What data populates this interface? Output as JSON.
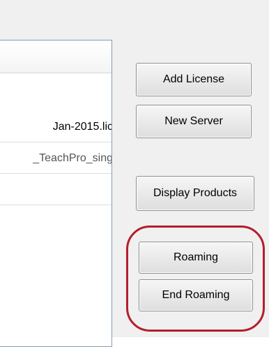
{
  "license_list": {
    "rows": [
      {
        "text": "Jan-2015.lic"
      },
      {
        "text": "_TeachPro_sing"
      },
      {
        "text": ""
      }
    ]
  },
  "buttons": {
    "add_license": "Add License",
    "new_server": "New Server",
    "display_products": "Display Products",
    "roaming": "Roaming",
    "end_roaming": "End Roaming"
  },
  "colors": {
    "highlight": "#b51d2b",
    "panel_bg": "#f0f0f0",
    "list_border": "#7f9db9"
  }
}
